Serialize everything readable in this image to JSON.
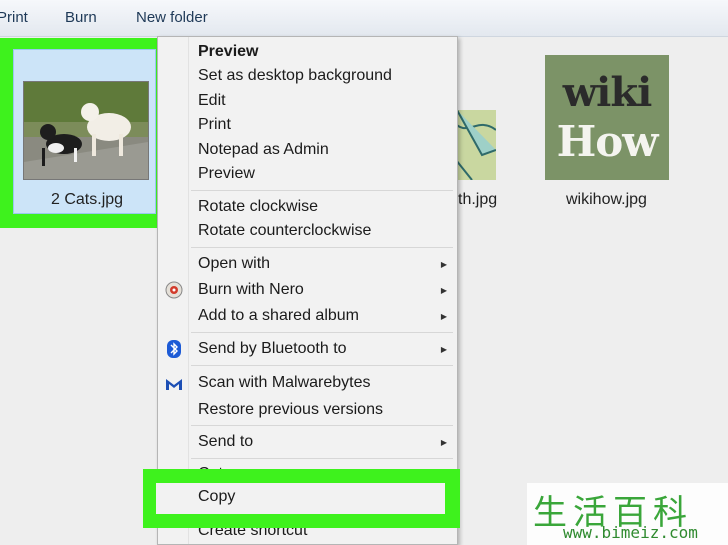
{
  "toolbar": {
    "print": "Print",
    "burn": "Burn",
    "new_folder": "New folder"
  },
  "files": {
    "cats": "2 Cats.jpg",
    "middle": "th.jpg",
    "wikihow": "wikihow.jpg",
    "wiki_logo_line1": "wiki",
    "wiki_logo_line2": "How"
  },
  "context_menu": {
    "preview_bold": "Preview",
    "set_desktop_bg": "Set as desktop background",
    "edit": "Edit",
    "print": "Print",
    "notepad_admin": "Notepad as Admin",
    "preview": "Preview",
    "rotate_cw": "Rotate clockwise",
    "rotate_ccw": "Rotate counterclockwise",
    "open_with": "Open with",
    "burn_nero": "Burn with Nero",
    "add_shared_album": "Add to a shared album",
    "send_bluetooth": "Send by Bluetooth to",
    "scan_malwarebytes": "Scan with Malwarebytes",
    "restore_versions": "Restore previous versions",
    "send_to": "Send to",
    "cut": "Cut",
    "copy": "Copy",
    "create_shortcut": "Create shortcut"
  },
  "watermark": {
    "chinese": "生活百科",
    "url": "www.bimeiz.com"
  },
  "colors": {
    "highlight_green": "#3ef21d",
    "selection_blue": "#cce4f8"
  }
}
